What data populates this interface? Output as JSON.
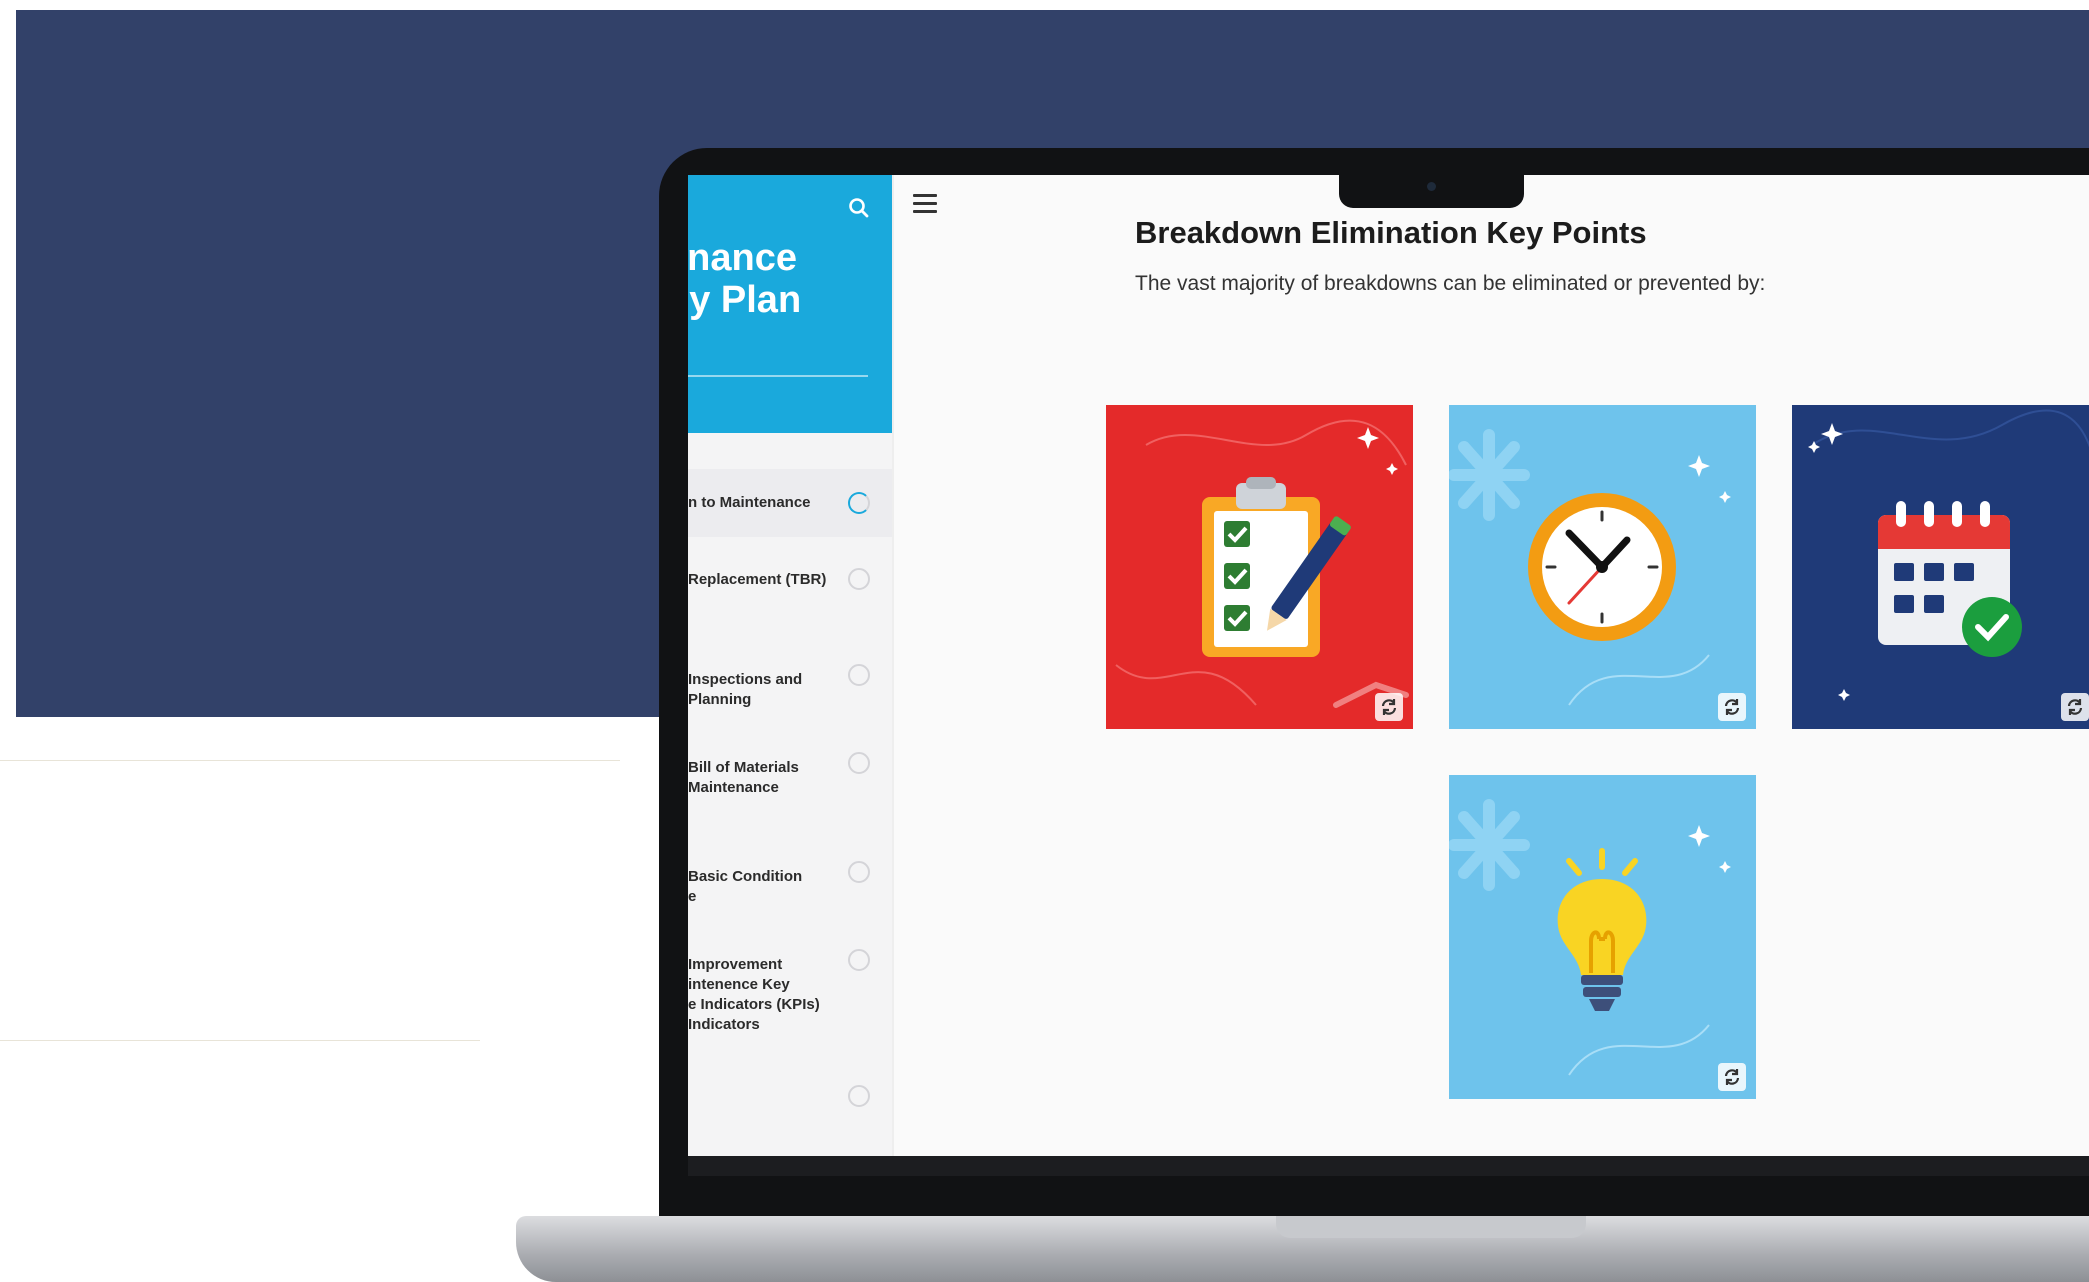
{
  "sidebar": {
    "title_lines": [
      "enance",
      "gy Plan"
    ],
    "items": [
      {
        "label": "n to Maintenance",
        "state": "in-progress"
      },
      {
        "label": "Replacement (TBR)",
        "state": "not-started"
      },
      {
        "label": "Inspections and\nPlanning",
        "state": "not-started"
      },
      {
        "label": "Bill of Materials\nMaintenance",
        "state": "not-started"
      },
      {
        "label": "Basic Condition\ne",
        "state": "not-started"
      },
      {
        "label": "Improvement\nintenence Key\ne Indicators (KPIs)\n Indicators",
        "state": "not-started"
      },
      {
        "label": "",
        "state": "not-started"
      }
    ]
  },
  "main": {
    "title": "Breakdown Elimination Key Points",
    "subtitle": "The vast majority of breakdowns can be eliminated or prevented by:"
  },
  "cards": [
    {
      "icon": "clipboard-checklist-icon",
      "bg": "#e42a2a"
    },
    {
      "icon": "clock-icon",
      "bg": "#6ec3ec"
    },
    {
      "icon": "calendar-check-icon",
      "bg": "#1f3a78"
    },
    {
      "icon": "lightbulb-icon",
      "bg": "#6ec3ec"
    }
  ],
  "colors": {
    "background_band": "#324169",
    "sidebar_accent": "#1aa9dc"
  }
}
